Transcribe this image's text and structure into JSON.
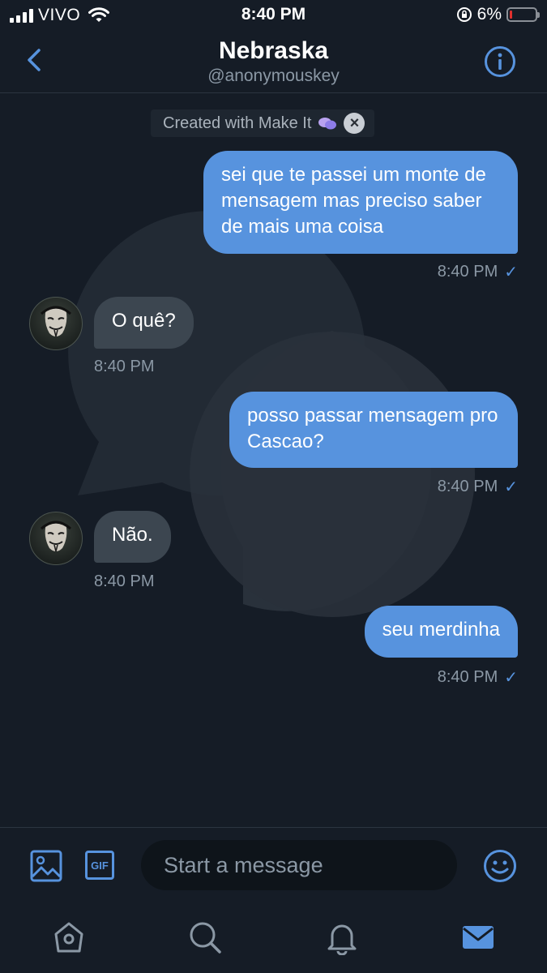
{
  "status_bar": {
    "carrier": "VIVO",
    "time": "8:40 PM",
    "battery_percent": "6%"
  },
  "header": {
    "title": "Nebraska",
    "handle": "@anonymouskey"
  },
  "banner": {
    "text": "Created with Make It"
  },
  "messages": [
    {
      "direction": "outgoing",
      "text": "sei que te passei um monte de mensagem mas preciso saber de mais uma coisa",
      "time": "8:40 PM",
      "status": "✓"
    },
    {
      "direction": "incoming",
      "text": "O quê?",
      "time": "8:40 PM"
    },
    {
      "direction": "outgoing",
      "text": "posso passar mensagem pro Cascao?",
      "time": "8:40 PM",
      "status": "✓"
    },
    {
      "direction": "incoming",
      "text": "Não.",
      "time": "8:40 PM"
    },
    {
      "direction": "outgoing",
      "text": "seu merdinha",
      "time": "8:40 PM",
      "status": "✓"
    }
  ],
  "composer": {
    "placeholder": "Start a message",
    "gif_label": "GIF"
  },
  "colors": {
    "background": "#151c26",
    "accent": "#5793de",
    "incoming_bubble": "#3c4650"
  }
}
